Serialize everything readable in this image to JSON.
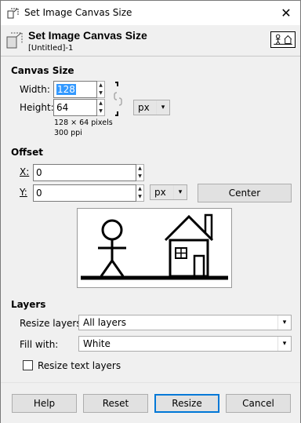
{
  "window": {
    "title": "Set Image Canvas Size",
    "close_glyph": "✕"
  },
  "header": {
    "title": "Set Image Canvas Size",
    "subtitle": "[Untitled]-1"
  },
  "canvas_size": {
    "section_title": "Canvas Size",
    "width_label": "Width:",
    "height_label": "Height:",
    "width_value": "128",
    "height_value": "64",
    "unit": "px",
    "pixel_info": "128 × 64 pixels",
    "ppi_info": "300 ppi"
  },
  "offset": {
    "section_title": "Offset",
    "x_label": "X:",
    "y_label": "Y:",
    "x_value": "0",
    "y_value": "0",
    "unit": "px",
    "center_label": "Center"
  },
  "layers": {
    "section_title": "Layers",
    "resize_layers_label": "Resize layers:",
    "resize_layers_value": "All layers",
    "fill_with_label": "Fill with:",
    "fill_with_value": "White",
    "resize_text_layers_label": "Resize text layers",
    "resize_text_layers_checked": false
  },
  "buttons": {
    "help": "Help",
    "reset": "Reset",
    "resize": "Resize",
    "cancel": "Cancel"
  },
  "icons": {
    "dropdown": "▾",
    "spin_up": "▲",
    "spin_down": "▼"
  }
}
